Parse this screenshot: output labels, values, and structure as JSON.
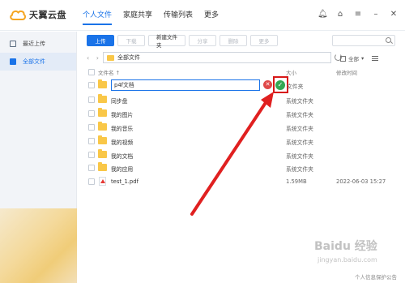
{
  "app": {
    "logo_text": "天翼云盘"
  },
  "nav": [
    "个人文件",
    "家庭共享",
    "传输列表",
    "更多"
  ],
  "sidebar": {
    "items": [
      {
        "label": "最近上传"
      },
      {
        "label": "全部文件"
      }
    ]
  },
  "toolbar": {
    "upload": "上传",
    "download": "下载",
    "new_folder": "新建文件夹",
    "share": "分享",
    "delete": "删除",
    "more": "更多"
  },
  "path": {
    "current": "全部文件"
  },
  "view": {
    "filter": "全部"
  },
  "table": {
    "headers": {
      "name": "文件名 ↑",
      "size": "大小",
      "modified": "修改时间"
    },
    "rename": {
      "value": "p4f文档",
      "type": "文件夹"
    },
    "rows": [
      {
        "name": "同步盘",
        "type": "系统文件夹",
        "date": ""
      },
      {
        "name": "我的图片",
        "type": "系统文件夹",
        "date": ""
      },
      {
        "name": "我的音乐",
        "type": "系统文件夹",
        "date": ""
      },
      {
        "name": "我的视频",
        "type": "系统文件夹",
        "date": ""
      },
      {
        "name": "我的文档",
        "type": "系统文件夹",
        "date": ""
      },
      {
        "name": "我的应用",
        "type": "系统文件夹",
        "date": ""
      },
      {
        "name": "test_1.pdf",
        "type": "1.59MB",
        "date": "2022-06-03 15:27"
      }
    ]
  },
  "footer": {
    "link": "个人信息保护公告"
  },
  "watermark": {
    "line1": "Baidu 经验",
    "line2": "jingyan.baidu.com"
  },
  "colors": {
    "accent": "#1a73e8",
    "highlight": "#d71919",
    "confirm": "#34a853",
    "cancel": "#e04848"
  }
}
